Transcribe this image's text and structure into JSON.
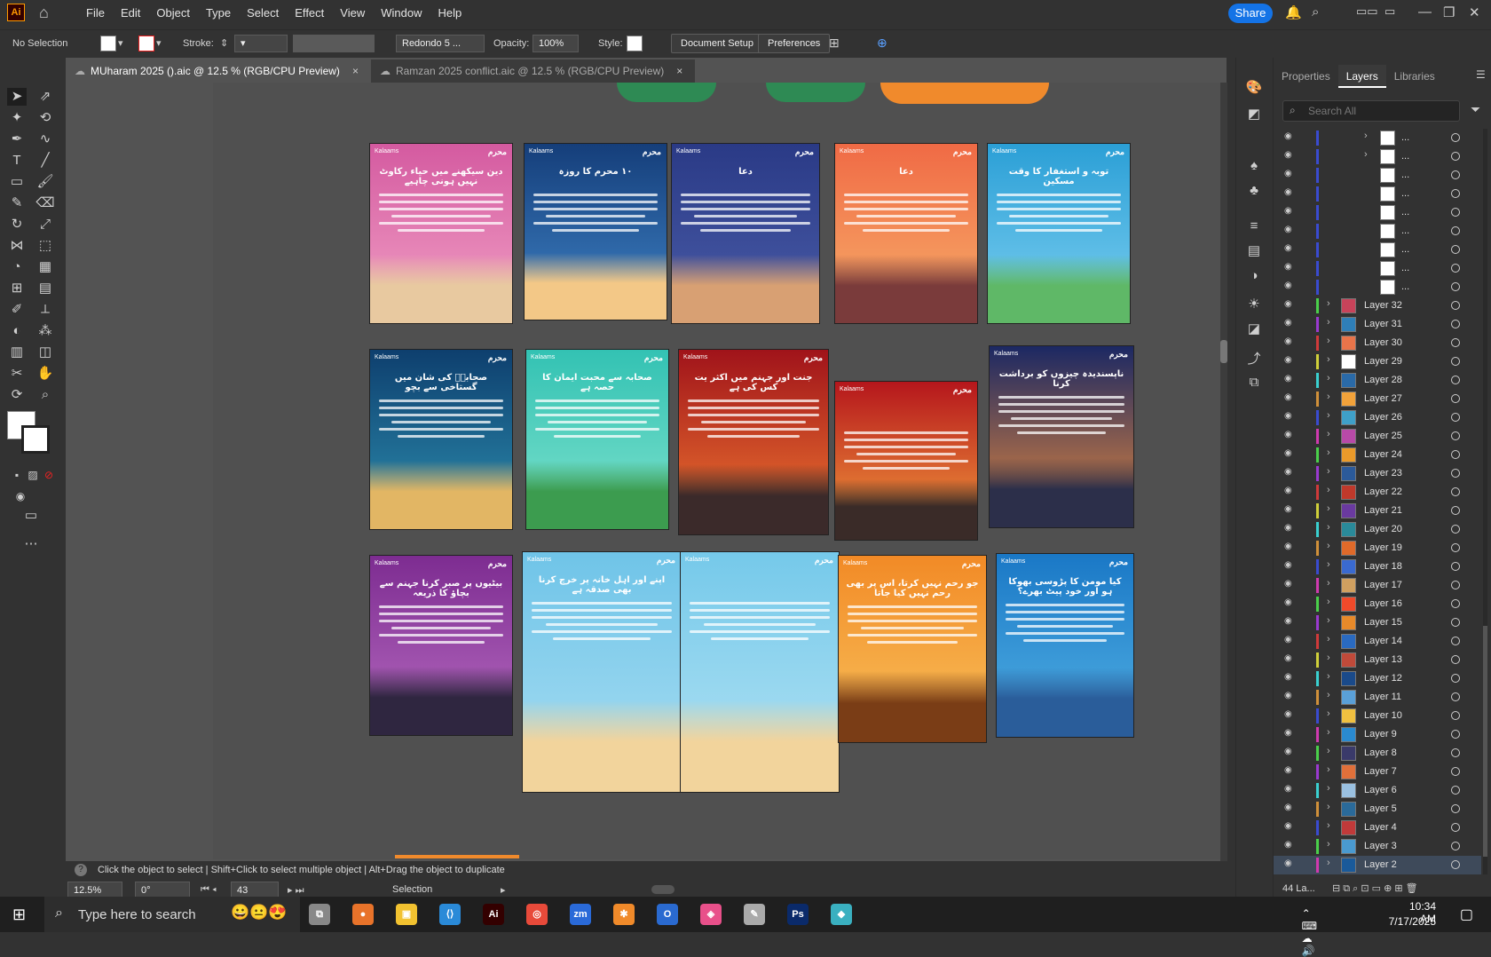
{
  "app": {
    "logo": "Ai",
    "share_label": "Share"
  },
  "menu": [
    "File",
    "Edit",
    "Object",
    "Type",
    "Select",
    "Effect",
    "View",
    "Window",
    "Help"
  ],
  "control": {
    "selection_label": "No Selection",
    "stroke_label": "Stroke:",
    "brush_label": "Redondo 5 ...",
    "opacity_label": "Opacity:",
    "opacity_value": "100%",
    "style_label": "Style:",
    "doc_setup_label": "Document Setup",
    "prefs_label": "Preferences"
  },
  "tabs": [
    {
      "label": "MUharam 2025 ().aic @ 12.5 % (RGB/CPU Preview)",
      "close": "×"
    },
    {
      "label": "Ramzan 2025 conflict.aic @ 12.5 % (RGB/CPU Preview)",
      "close": "×"
    }
  ],
  "cards": [
    {
      "title": "دین سیکھنے میں حیاء رکاوٹ نہیں ہونی چاہیے",
      "brand": "Kalaams",
      "mark": "محرم",
      "top": "#d45aa0",
      "bottom": "#f2a2c6",
      "ground": "#e8c9a0"
    },
    {
      "title": "۱۰ محرم کا روزہ",
      "brand": "Kalaams",
      "mark": "محرم",
      "top": "#153e7a",
      "bottom": "#3f83c6",
      "ground": "#f3c887"
    },
    {
      "title": "دعا",
      "brand": "Kalaams",
      "mark": "محرم",
      "top": "#2a3a86",
      "bottom": "#4a5ca8",
      "ground": "#d8a073"
    },
    {
      "title": "دعا",
      "brand": "Kalaams",
      "mark": "محرم",
      "top": "#f06a45",
      "bottom": "#f7b06b",
      "ground": "#7a3b3b"
    },
    {
      "title": "توبہ و استغفار کا وقت مسکین",
      "brand": "Kalaams",
      "mark": "محرم",
      "top": "#2b9fd6",
      "bottom": "#7dd0f1",
      "ground": "#5fb867"
    },
    {
      "title": "صحابہؓ کی شان میں گستاخی سے بچو",
      "brand": "Kalaams",
      "mark": "محرم",
      "top": "#0e3f6e",
      "bottom": "#2d8fb0",
      "ground": "#e2b664"
    },
    {
      "title": "صحابہ سے محبت ایمان کا حصہ ہے",
      "brand": "Kalaams",
      "mark": "محرم",
      "top": "#33c2b3",
      "bottom": "#7fe2cd",
      "ground": "#3c9c4f"
    },
    {
      "title": "جنت اور جہنم میں اکثر یت کس کی ہے",
      "brand": "Kalaams",
      "mark": "محرم",
      "top": "#a0131a",
      "bottom": "#f27b31",
      "ground": "#3b2a2a"
    },
    {
      "title": "",
      "brand": "Kalaams",
      "mark": "محرم",
      "top": "#b5161c",
      "bottom": "#f6a23d",
      "ground": "#3a2b28"
    },
    {
      "title": "ناپسندیدہ چیزوں کو برداشت کرنا",
      "brand": "Kalaams",
      "mark": "محرم",
      "top": "#1b2863",
      "bottom": "#e98a3c",
      "ground": "#2c2f4a"
    },
    {
      "title": "بیٹیوں پر صبر کرنا جہنم سے بچاؤ کا ذریعہ",
      "brand": "Kalaams",
      "mark": "محرم",
      "top": "#7d2c91",
      "bottom": "#b66bc0",
      "ground": "#2f2640"
    },
    {
      "title": "اپنے اور اہل خانہ پر خرچ کرنا بھی صدقہ ہے",
      "brand": "Kalaams",
      "mark": "محرم",
      "top": "#6fc4e8",
      "bottom": "#a9def2",
      "ground": "#f2d49c"
    },
    {
      "title": "",
      "brand": "Kalaams",
      "mark": "محرم",
      "top": "#75c9ea",
      "bottom": "#b2e2f3",
      "ground": "#f2d49c"
    },
    {
      "title": "جو رحم نہیں کرتا، اس پر بھی رحم نہیں کیا جاتا",
      "brand": "Kalaams",
      "mark": "محرم",
      "top": "#f28a26",
      "bottom": "#f8c25c",
      "ground": "#7a3d16"
    },
    {
      "title": "کیا مومن کا پڑوسی بھوکا ہو اور خود پیٹ بھرے؟",
      "brand": "Kalaams",
      "mark": "محرم",
      "top": "#1a78c6",
      "bottom": "#52b1e4",
      "ground": "#2a5d9a"
    }
  ],
  "status": {
    "hint": "Click the object to select  |  Shift+Click to select multiple object  |  Alt+Drag the object to duplicate",
    "zoom": "12.5%",
    "rotation": "0°",
    "artboard": "43",
    "mode": "Selection"
  },
  "panel": {
    "tabs": [
      "Properties",
      "Layers",
      "Libraries"
    ],
    "active_tab": "Layers",
    "search_placeholder": "Search All",
    "top_items": [
      {
        "label": "...",
        "bar": "#3a4bd0",
        "chev": "›"
      },
      {
        "label": "...",
        "bar": "#3a4bd0",
        "chev": "›"
      },
      {
        "label": "...",
        "bar": "#3a4bd0",
        "chev": ""
      },
      {
        "label": "...",
        "bar": "#3a4bd0",
        "chev": ""
      },
      {
        "label": "...",
        "bar": "#3a4bd0",
        "chev": ""
      },
      {
        "label": "...",
        "bar": "#3a4bd0",
        "chev": ""
      },
      {
        "label": "...",
        "bar": "#3a4bd0",
        "chev": ""
      },
      {
        "label": "...",
        "bar": "#3a4bd0",
        "chev": ""
      },
      {
        "label": "...",
        "bar": "#3a4bd0",
        "chev": ""
      }
    ],
    "layers": [
      {
        "label": "Layer 32",
        "bar": "#4ad04a"
      },
      {
        "label": "Layer 31",
        "bar": "#9a3ad0"
      },
      {
        "label": "Layer 30",
        "bar": "#d03a3a"
      },
      {
        "label": "Layer 29",
        "bar": "#d0d03a"
      },
      {
        "label": "Layer 28",
        "bar": "#3ad0d0"
      },
      {
        "label": "Layer 27",
        "bar": "#d0903a"
      },
      {
        "label": "Layer 26",
        "bar": "#3a4bd0"
      },
      {
        "label": "Layer 25",
        "bar": "#d03ab0"
      },
      {
        "label": "Layer 24",
        "bar": "#4ad04a"
      },
      {
        "label": "Layer 23",
        "bar": "#9a3ad0"
      },
      {
        "label": "Layer 22",
        "bar": "#d03a3a"
      },
      {
        "label": "Layer 21",
        "bar": "#d0d03a"
      },
      {
        "label": "Layer 20",
        "bar": "#3ad0d0"
      },
      {
        "label": "Layer 19",
        "bar": "#d0903a"
      },
      {
        "label": "Layer 18",
        "bar": "#3a4bd0"
      },
      {
        "label": "Layer 17",
        "bar": "#d03ab0"
      },
      {
        "label": "Layer 16",
        "bar": "#4ad04a"
      },
      {
        "label": "Layer 15",
        "bar": "#9a3ad0"
      },
      {
        "label": "Layer 14",
        "bar": "#d03a3a"
      },
      {
        "label": "Layer 13",
        "bar": "#d0d03a"
      },
      {
        "label": "Layer 12",
        "bar": "#3ad0d0"
      },
      {
        "label": "Layer 11",
        "bar": "#d0903a"
      },
      {
        "label": "Layer 10",
        "bar": "#3a4bd0"
      },
      {
        "label": "Layer 9",
        "bar": "#d03ab0"
      },
      {
        "label": "Layer 8",
        "bar": "#4ad04a"
      },
      {
        "label": "Layer 7",
        "bar": "#9a3ad0"
      },
      {
        "label": "Layer 6",
        "bar": "#3ad0d0"
      },
      {
        "label": "Layer 5",
        "bar": "#d0903a"
      },
      {
        "label": "Layer 4",
        "bar": "#3a4bd0"
      },
      {
        "label": "Layer 3",
        "bar": "#4ad04a"
      },
      {
        "label": "Layer 2",
        "bar": "#d03ab0"
      }
    ],
    "count": "44 La..."
  },
  "taskbar": {
    "search_placeholder": "Type here to search",
    "time": "10:34 AM",
    "date": "7/17/2025",
    "apps": [
      "task-view",
      "firefox",
      "file-explorer",
      "vscode",
      "illustrator",
      "chrome",
      "zoom",
      "app-orange",
      "outlook",
      "app-pink",
      "app-pen",
      "photoshop",
      "app-teal"
    ]
  }
}
